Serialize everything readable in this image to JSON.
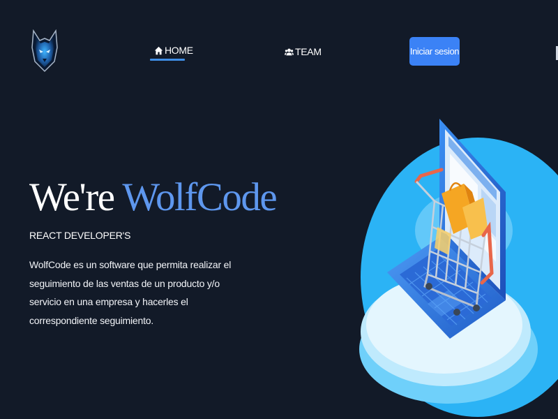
{
  "brand": {
    "logo_icon": "wolf-logo-icon"
  },
  "nav": {
    "home": {
      "label": "HOME",
      "icon": "home-icon",
      "active": true
    },
    "team": {
      "label": "TEAM",
      "icon": "users-icon"
    },
    "login_label": "Iniciar sesion"
  },
  "hero": {
    "title_prefix": "We're ",
    "title_accent": "WolfCode",
    "subtitle": "REACT DEVELOPER'S",
    "description": "WolfCode es un software que permita realizar el seguimiento de las ventas de un producto y/o servicio en una empresa y hacerles el correspondiente seguimiento.",
    "illustration_icon": "shopping-cart-laptop-illustration"
  },
  "colors": {
    "background": "#121a28",
    "accent": "#5e97ee",
    "button": "#3b82f6",
    "underline": "#3f8ee6",
    "circle": "#2bb3f5"
  }
}
